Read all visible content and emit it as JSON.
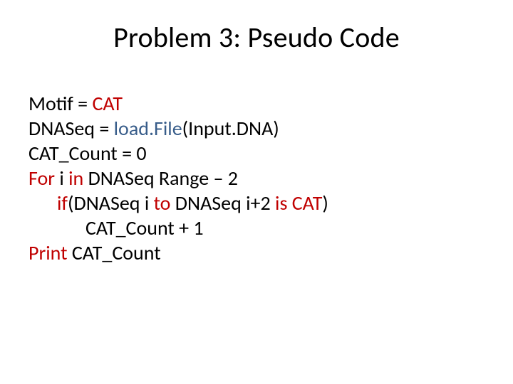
{
  "title": "Problem 3: Pseudo Code",
  "code": {
    "l1a": "Motif = ",
    "l1b": "CAT",
    "l2a": "DNASeq = ",
    "l2b": "load.File",
    "l2c": "(Input.DNA)",
    "l3": "CAT_Count = 0",
    "l4a": "For",
    "l4b": " i ",
    "l4c": "in",
    "l4d": " DNASeq Range – 2",
    "l5a": "if",
    "l5b": "(DNASeq i ",
    "l5c": "to",
    "l5d": " DNASeq i+2 ",
    "l5e": "is",
    "l5f": " ",
    "l5g": "CAT",
    "l5h": ")",
    "l6": "CAT_Count + 1",
    "l7a": "Print",
    "l7b": " CAT_Count"
  }
}
